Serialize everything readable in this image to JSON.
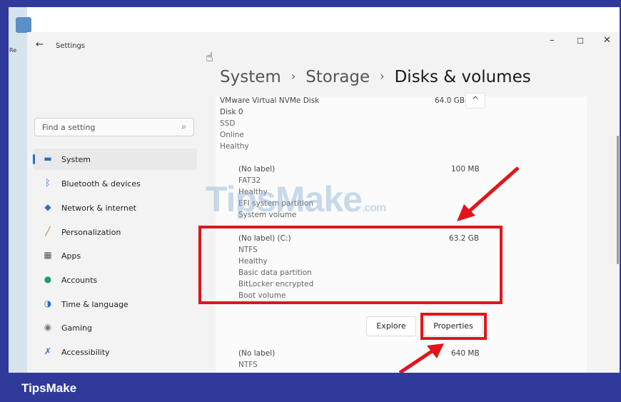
{
  "desktop": {
    "shortcut_label": "Re"
  },
  "window": {
    "title": "Settings",
    "back_icon": "←",
    "minimize": "–",
    "maximize": "☐",
    "close": "✕"
  },
  "search": {
    "placeholder": "Find a setting",
    "icon": "⌕"
  },
  "sidebar": {
    "items": [
      {
        "label": "System",
        "icon": "monitor-icon",
        "glyph": "▬",
        "color": "#2b6cd4"
      },
      {
        "label": "Bluetooth & devices",
        "icon": "bluetooth-icon",
        "glyph": "ᛒ",
        "color": "#2b6cd4"
      },
      {
        "label": "Network & internet",
        "icon": "wifi-icon",
        "glyph": "◆",
        "color": "#2b6cd4"
      },
      {
        "label": "Personalization",
        "icon": "brush-icon",
        "glyph": "╱",
        "color": "#c9781e"
      },
      {
        "label": "Apps",
        "icon": "apps-icon",
        "glyph": "▦",
        "color": "#555555"
      },
      {
        "label": "Accounts",
        "icon": "person-icon",
        "glyph": "●",
        "color": "#1f9d6a"
      },
      {
        "label": "Time & language",
        "icon": "globe-clock-icon",
        "glyph": "◑",
        "color": "#2b6cd4"
      },
      {
        "label": "Gaming",
        "icon": "gamepad-icon",
        "glyph": "◉",
        "color": "#777777"
      },
      {
        "label": "Accessibility",
        "icon": "accessibility-icon",
        "glyph": "✗",
        "color": "#2b6cd4"
      }
    ]
  },
  "breadcrumb": {
    "part1": "System",
    "part2": "Storage",
    "current": "Disks & volumes",
    "separator": "›"
  },
  "disk": {
    "name": "VMware Virtual NVMe Disk",
    "size": "64.0 GB",
    "collapse_icon": "^",
    "lines": [
      "Disk 0",
      "SSD",
      "Online",
      "Healthy"
    ]
  },
  "volumes": [
    {
      "label": "(No label)",
      "size": "100 MB",
      "lines": [
        "FAT32",
        "Healthy",
        "EFI system partition",
        "System volume"
      ]
    },
    {
      "label": "(No label) (C:)",
      "size": "63.2 GB",
      "lines": [
        "NTFS",
        "Healthy",
        "Basic data partition",
        "BitLocker encrypted",
        "Boot volume"
      ]
    },
    {
      "label": "(No label)",
      "size": "640 MB",
      "lines": [
        "NTFS"
      ]
    }
  ],
  "buttons": {
    "explore": "Explore",
    "properties": "Properties"
  },
  "watermark": {
    "text": "TipsMake",
    "suffix": ".com"
  },
  "footer": {
    "brand": "TipsMake"
  },
  "annotation_color": "#e0161b"
}
